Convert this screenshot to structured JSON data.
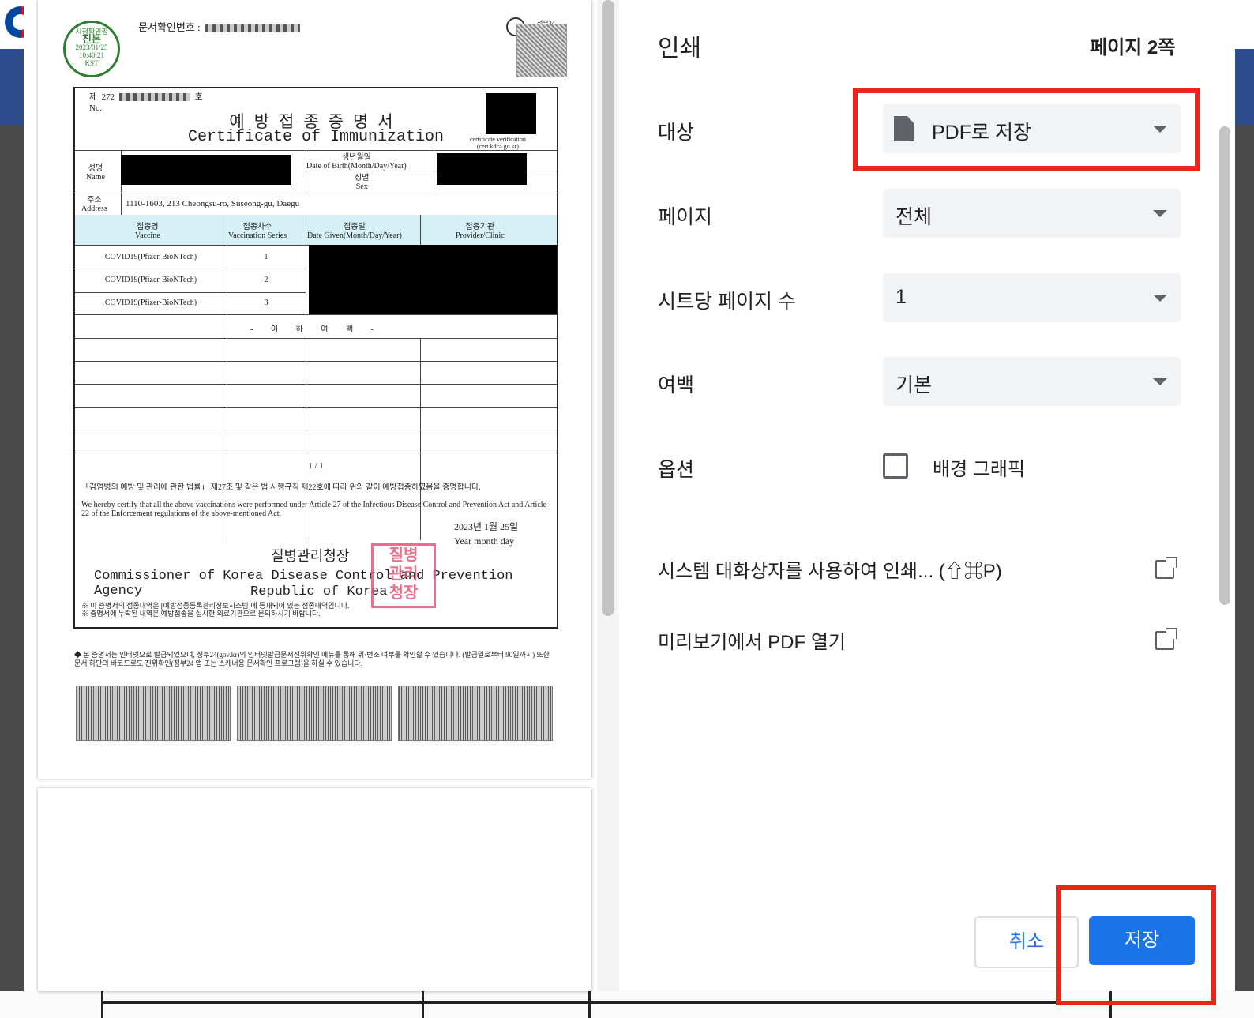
{
  "print_dialog": {
    "title": "인쇄",
    "page_count": "페이지 2쪽",
    "destination": {
      "label": "대상",
      "value": "PDF로 저장"
    },
    "pages": {
      "label": "페이지",
      "value": "전체"
    },
    "pages_per_sheet": {
      "label": "시트당 페이지 수",
      "value": "1"
    },
    "margins": {
      "label": "여백",
      "value": "기본"
    },
    "options": {
      "label": "옵션",
      "background_graphics": "배경 그래픽",
      "background_graphics_checked": false
    },
    "system_dialog_link": "시스템 대화상자를 사용하여 인쇄... (⇧⌘P)",
    "preview_pdf_link": "미리보기에서 PDF 열기",
    "cancel_label": "취소",
    "save_label": "저장",
    "accent_color": "#1a73e8",
    "highlight_color": "#e8251a"
  },
  "document": {
    "doc_no_label": "문서확인번호 :",
    "seal_top": "시청확인필",
    "seal_main": "진본",
    "seal_date": "2023/01/25",
    "seal_time": "10:40:21",
    "seal_tz": "KST",
    "seal_bottom": "정부시청확인센터",
    "gov24": "정부24",
    "cert_no_ko": "제",
    "cert_no_prefix": "272",
    "cert_no_suffix": "호",
    "cert_no_en": "No.",
    "title_ko": "예방접종증명서",
    "title_en": "Certificate of Immunization",
    "cert_verification": "certificate verification",
    "cert_site": "(cert.kdca.go.kr)",
    "name_ko": "성명",
    "name_en": "Name",
    "dob_ko": "생년월일",
    "dob_en": "Date of Birth(Month/Day/Year)",
    "sex_ko": "성별",
    "sex_en": "Sex",
    "address_ko": "주소",
    "address_en": "Address",
    "address_value": "1110-1603, 213 Cheongsu-ro, Suseong-gu, Daegu",
    "col_vaccine_ko": "접종명",
    "col_vaccine_en": "Vaccine",
    "col_series_ko": "접종차수",
    "col_series_en": "Vaccination Series",
    "col_date_ko": "접종일",
    "col_date_en": "Date Given(Month/Day/Year)",
    "col_provider_ko": "접종기관",
    "col_provider_en": "Provider/Clinic",
    "rows": [
      {
        "vaccine": "COVID19(Pfizer-BioNTech)",
        "series": "1"
      },
      {
        "vaccine": "COVID19(Pfizer-BioNTech)",
        "series": "2"
      },
      {
        "vaccine": "COVID19(Pfizer-BioNTech)",
        "series": "3"
      }
    ],
    "blank_marker": "- 이 하 여 백 -",
    "page_indicator": "1 / 1",
    "legal_ko": "「감염병의 예방 및 관리에 관한 법률」 제27조 및 같은 법 시행규칙 제22호에 따라 위와 같이 예방접종하였음을 증명합니다.",
    "legal_en": "We hereby certify that all the above vaccinations were performed under Article 27 of the Infectious Disease Control and Prevention Act and Article 22 of the Enforcement regulations of the above-mentioned Act.",
    "issue_date": "2023년  1월 25일",
    "issue_date_en": "Year  month  day",
    "issuer_ko": "질병관리청장",
    "issuer_en": "Commissioner of Korea Disease Control and Prevention Agency",
    "issuer_country": "Republic of Korea",
    "note1": "※ 이 증명서의 접종내역은 [예방접종등록관리정보시스템]에 등재되어 있는 접종내역입니다.",
    "note2": "※ 증명서에 누락된 내역은 예방접종을 실시한 의료기관으로 문의하시기 바랍니다.",
    "footer_note": "◆ 본 증명서는 인터넷으로 발급되었으며, 정부24(gov.kr)의 인터넷발급문서진위확인 메뉴를 통해 위·변조 여부를 확인할 수 있습니다. (발급일로부터 90일까지) 또한 문서 하단의 바코드로도 진위확인(정부24 앱 또는 스캐너용 문서확인 프로그램)을 하실 수 있습니다.",
    "stamp_text": "질병관리청장인"
  }
}
